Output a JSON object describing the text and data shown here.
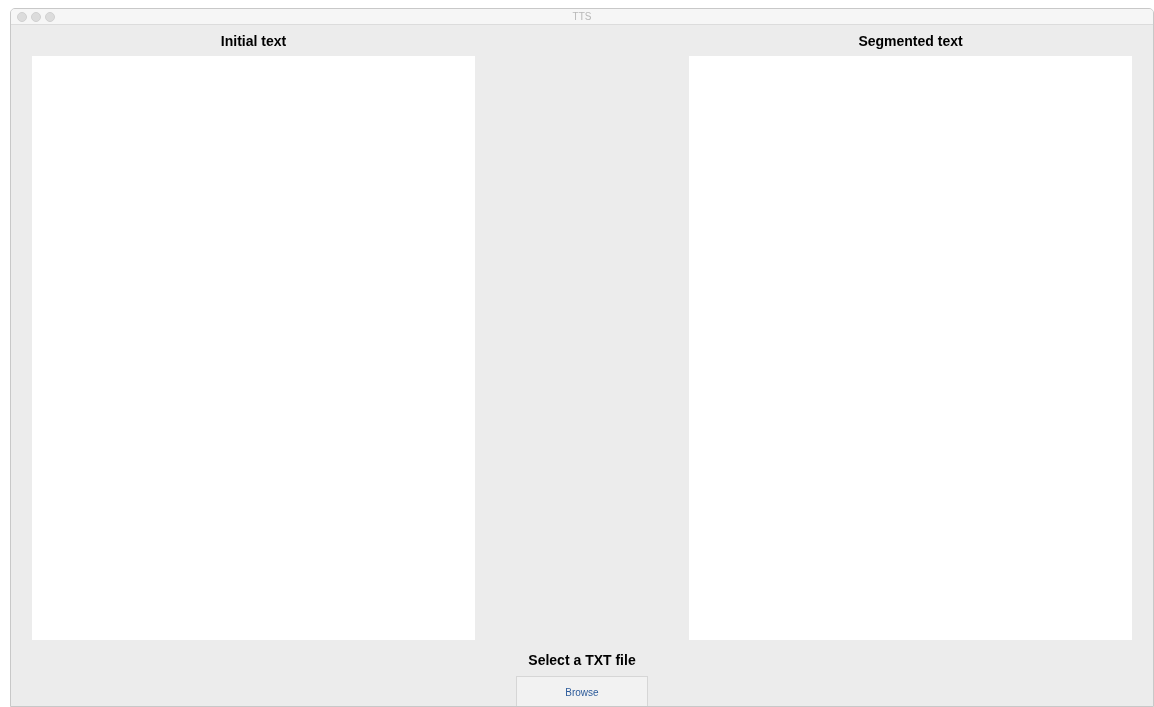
{
  "window": {
    "title": "TTS"
  },
  "panels": [
    {
      "title": "Initial text"
    },
    {
      "title": "Segmented text"
    }
  ],
  "file_select": {
    "label": "Select a TXT file",
    "button": "Browse"
  }
}
